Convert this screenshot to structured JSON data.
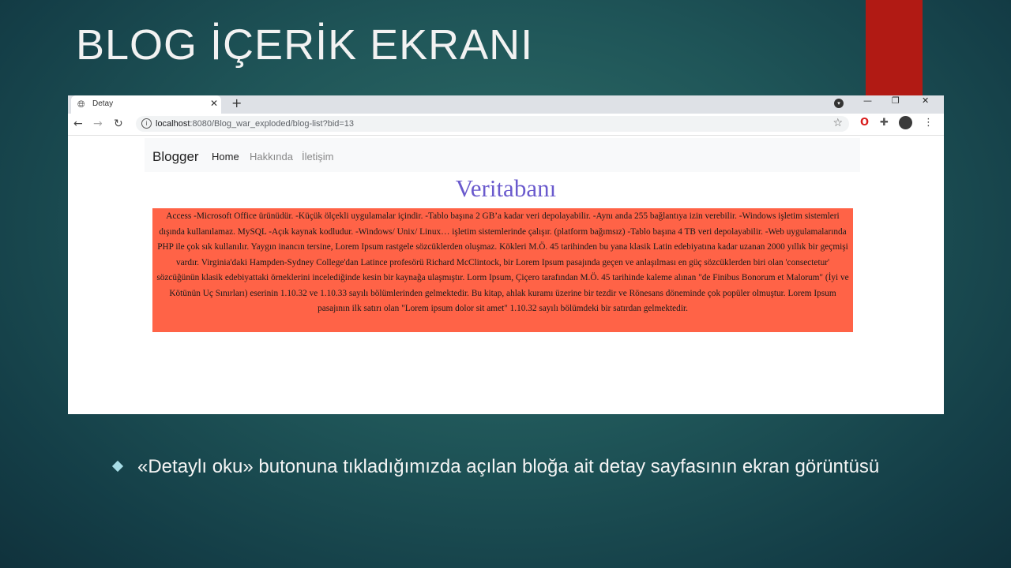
{
  "slide": {
    "title": "BLOG İÇERİK EKRANI",
    "bullet": "«Detaylı oku» butonuna tıkladığımızda açılan bloğa ait detay sayfasının ekran görüntüsü"
  },
  "browser": {
    "tab_title": "Detay",
    "tab_close": "✕",
    "new_tab": "+",
    "url_host": "localhost",
    "url_path": ":8080/Blog_war_exploded/blog-list?bid=13",
    "window_controls": {
      "minimize": "—",
      "restore": "❐",
      "close": "✕"
    }
  },
  "site": {
    "brand": "Blogger",
    "nav": {
      "home": "Home",
      "about": "Hakkında",
      "contact": "İletişim"
    },
    "post_title": "Veritabanı",
    "post_body": "Access -Microsoft Office ürünüdür. -Küçük ölçekli uygulamalar içindir. -Tablo başına 2 GB’a kadar veri depolayabilir. -Aynı anda 255 bağlantıya izin verebilir. -Windows işletim sistemleri dışında kullanılamaz. MySQL -Açık kaynak kodludur. -Windows/ Unix/ Linux… işletim sistemlerinde çalışır. (platform bağımsız) -Tablo başına 4 TB veri depolayabilir. -Web uygulamalarında PHP ile çok sık kullanılır. Yaygın inancın tersine, Lorem Ipsum rastgele sözcüklerden oluşmaz. Kökleri M.Ö. 45 tarihinden bu yana klasik Latin edebiyatına kadar uzanan 2000 yıllık bir geçmişi vardır. Virginia'daki Hampden-Sydney College'dan Latince profesörü Richard McClintock, bir Lorem Ipsum pasajında geçen ve anlaşılması en güç sözcüklerden biri olan 'consectetur' sözcüğünün klasik edebiyattaki örneklerini incelediğinde kesin bir kaynağa ulaşmıştır. Lorm Ipsum, Çiçero tarafından M.Ö. 45 tarihinde kaleme alınan \"de Finibus Bonorum et Malorum\" (İyi ve Kötünün Uç Sınırları) eserinin 1.10.32 ve 1.10.33 sayılı bölümlerinden gelmektedir. Bu kitap, ahlak kuramı üzerine bir tezdir ve Rönesans döneminde çok popüler olmuştur. Lorem Ipsum pasajının ilk satırı olan \"Lorem ipsum dolor sit amet\" 1.10.32 sayılı bölümdeki bir satırdan gelmektedir."
  },
  "colors": {
    "title_accent": "#6a5acd",
    "post_background": "#ff6347",
    "slide_red_bar": "#b11a14"
  },
  "icons": [
    "globe-icon",
    "close-icon",
    "plus-icon",
    "back-icon",
    "forward-icon",
    "reload-icon",
    "info-icon",
    "star-icon",
    "opera-icon",
    "puzzle-icon",
    "avatar",
    "kebab-menu-icon",
    "tab-search-icon"
  ]
}
